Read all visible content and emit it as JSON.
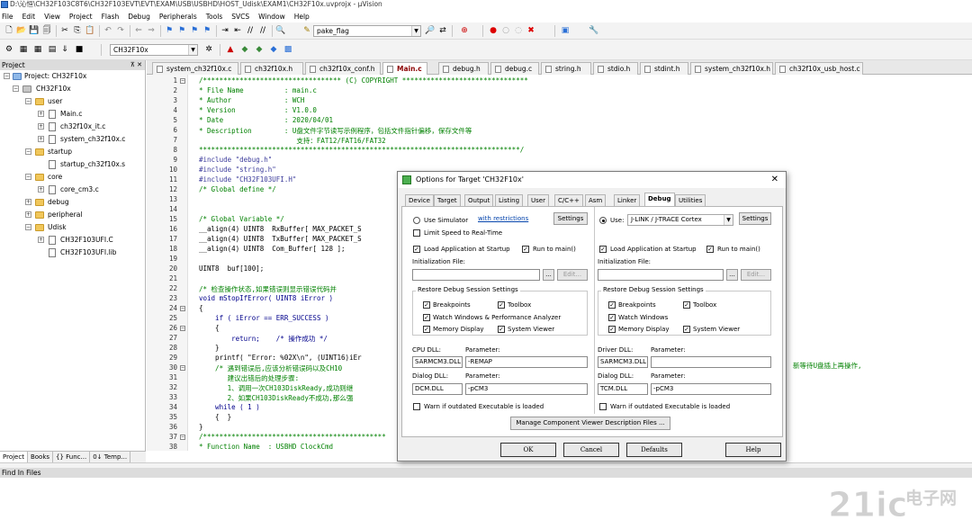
{
  "title_bar": "D:\\沁恒\\CH32F103C8T6\\CH32F103EVT\\EVT\\EXAM\\USB\\USBHD\\HOST_Udisk\\EXAM1\\CH32F10x.uvprojx - µVision",
  "menu": [
    "File",
    "Edit",
    "View",
    "Project",
    "Flash",
    "Debug",
    "Peripherals",
    "Tools",
    "SVCS",
    "Window",
    "Help"
  ],
  "toolbar": {
    "find_combo": "pake_flag",
    "target_combo": "CH32F10x"
  },
  "project": {
    "header": "Project",
    "root": "Project: CH32F10x",
    "target": "CH32F10x",
    "items": [
      {
        "label": "user",
        "level": 1,
        "type": "folder"
      },
      {
        "label": "Main.c",
        "level": 2,
        "type": "file"
      },
      {
        "label": "ch32f10x_it.c",
        "level": 2,
        "type": "file"
      },
      {
        "label": "system_ch32f10x.c",
        "level": 2,
        "type": "file"
      },
      {
        "label": "startup",
        "level": 1,
        "type": "folder"
      },
      {
        "label": "startup_ch32f10x.s",
        "level": 2,
        "type": "file"
      },
      {
        "label": "core",
        "level": 1,
        "type": "folder"
      },
      {
        "label": "core_cm3.c",
        "level": 2,
        "type": "file"
      },
      {
        "label": "debug",
        "level": 1,
        "type": "folder"
      },
      {
        "label": "peripheral",
        "level": 1,
        "type": "folder"
      },
      {
        "label": "Udisk",
        "level": 1,
        "type": "folder"
      },
      {
        "label": "CH32F103UFI.C",
        "level": 2,
        "type": "file"
      },
      {
        "label": "CH32F103UFI.lib",
        "level": 2,
        "type": "file"
      }
    ]
  },
  "bottom_tabs": [
    "Project",
    "Books",
    "{} Func...",
    "0↓ Temp..."
  ],
  "build_output_title": "Find In Files",
  "file_tabs": [
    {
      "label": "system_ch32f10x.c",
      "active": false
    },
    {
      "label": "ch32f10x.h",
      "active": false
    },
    {
      "label": "ch32f10x_conf.h",
      "active": false
    },
    {
      "label": "Main.c",
      "active": true
    },
    {
      "label": "debug.h",
      "active": false
    },
    {
      "label": "debug.c",
      "active": false
    },
    {
      "label": "string.h",
      "active": false
    },
    {
      "label": "stdio.h",
      "active": false
    },
    {
      "label": "stdint.h",
      "active": false
    },
    {
      "label": "system_ch32f10x.h",
      "active": false
    },
    {
      "label": "ch32f10x_usb_host.c",
      "active": false
    }
  ],
  "code_lines": [
    {
      "n": "1",
      "t": "/********************************** (C) COPYRIGHT *******************************",
      "c": "cm"
    },
    {
      "n": "2",
      "t": "* File Name          : main.c",
      "c": "cm"
    },
    {
      "n": "3",
      "t": "* Author             : WCH",
      "c": "cm"
    },
    {
      "n": "4",
      "t": "* Version            : V1.0.0",
      "c": "cm"
    },
    {
      "n": "5",
      "t": "* Date               : 2020/04/01",
      "c": "cm"
    },
    {
      "n": "6",
      "t": "* Description        : U盘文件字节读写示例程序，包括文件指针偏移，保存文件等",
      "c": "cm"
    },
    {
      "n": "7",
      "t": "                        支持：FAT12/FAT16/FAT32",
      "c": "cm"
    },
    {
      "n": "8",
      "t": "*******************************************************************************/",
      "c": "cm"
    },
    {
      "n": "9",
      "t": "#include \"debug.h\"",
      "c": "pp"
    },
    {
      "n": "10",
      "t": "#include \"string.h\"",
      "c": "pp"
    },
    {
      "n": "11",
      "t": "#include \"CH32F103UFI.H\"",
      "c": "pp"
    },
    {
      "n": "12",
      "t": "/* Global define */",
      "c": "cm"
    },
    {
      "n": "13",
      "t": "",
      "c": ""
    },
    {
      "n": "14",
      "t": "",
      "c": ""
    },
    {
      "n": "15",
      "t": "/* Global Variable */",
      "c": "cm"
    },
    {
      "n": "16",
      "t": "__align(4) UINT8  RxBuffer[ MAX_PACKET_S",
      "c": ""
    },
    {
      "n": "17",
      "t": "__align(4) UINT8  TxBuffer[ MAX_PACKET_S",
      "c": ""
    },
    {
      "n": "18",
      "t": "__align(4) UINT8  Com_Buffer[ 128 ];",
      "c": ""
    },
    {
      "n": "19",
      "t": "",
      "c": ""
    },
    {
      "n": "20",
      "t": "UINT8  buf[100];",
      "c": ""
    },
    {
      "n": "21",
      "t": "",
      "c": ""
    },
    {
      "n": "22",
      "t": "/* 检查操作状态,如果错误则显示错误代码并",
      "c": "cm"
    },
    {
      "n": "23",
      "t": "void mStopIfError( UINT8 iError )",
      "c": "kw"
    },
    {
      "n": "24",
      "t": "{",
      "c": ""
    },
    {
      "n": "25",
      "t": "    if ( iError == ERR_SUCCESS )",
      "c": "kw"
    },
    {
      "n": "26",
      "t": "    {",
      "c": ""
    },
    {
      "n": "27",
      "t": "        return;    /* 操作成功 */",
      "c": "kw"
    },
    {
      "n": "28",
      "t": "    }",
      "c": ""
    },
    {
      "n": "29",
      "t": "    printf( \"Error: %02X\\n\", (UINT16)iEr",
      "c": ""
    },
    {
      "n": "30",
      "t": "    /* 遇到错误后,应该分析错误码以及CH10",
      "c": "cm"
    },
    {
      "n": "31",
      "t": "       建议出错后的处理步骤:",
      "c": "cm"
    },
    {
      "n": "32",
      "t": "       1、调用一次CH103DiskReady,成功则继",
      "c": "cm"
    },
    {
      "n": "33",
      "t": "       2、如果CH103DiskReady不成功,那么强",
      "c": "cm"
    },
    {
      "n": "34",
      "t": "    while ( 1 )",
      "c": "kw"
    },
    {
      "n": "35",
      "t": "    {  }",
      "c": ""
    },
    {
      "n": "36",
      "t": "}",
      "c": ""
    },
    {
      "n": "37",
      "t": "/*********************************************",
      "c": "cm"
    },
    {
      "n": "38",
      "t": "* Function Name  : USBHD ClockCmd",
      "c": "cm"
    }
  ],
  "code_right_fragment": "新等待U盘插上再操作,",
  "dialog": {
    "title": "Options for Target 'CH32F10x'",
    "tabs": [
      "Device",
      "Target",
      "Output",
      "Listing",
      "User",
      "C/C++",
      "Asm",
      "Linker",
      "Debug",
      "Utilities"
    ],
    "selected_tab": "Debug",
    "left": {
      "use_simulator": "Use Simulator",
      "with_restrictions": "with restrictions",
      "settings": "Settings",
      "limit_speed": "Limit Speed to Real-Time",
      "load_app": "Load Application at Startup",
      "run_to_main": "Run to main()",
      "init_file": "Initialization File:",
      "browse": "...",
      "edit": "Edit...",
      "restore": "Restore Debug Session Settings",
      "breakpoints": "Breakpoints",
      "toolbox": "Toolbox",
      "watch": "Watch Windows & Performance Analyzer",
      "memory": "Memory Display",
      "system_viewer": "System Viewer",
      "dll_label": "CPU DLL:",
      "param_label": "Parameter:",
      "dll_value": "SARMCM3.DLL",
      "param_value": "-REMAP",
      "dialog_dll_label": "Dialog DLL:",
      "dialog_param_label": "Parameter:",
      "dialog_dll_value": "DCM.DLL",
      "dialog_param_value": "-pCM3",
      "warn": "Warn if outdated Executable is loaded"
    },
    "right": {
      "use": "Use:",
      "driver": "J-LINK / J-TRACE Cortex",
      "settings": "Settings",
      "load_app": "Load Application at Startup",
      "run_to_main": "Run to main()",
      "init_file": "Initialization File:",
      "browse": "...",
      "edit": "Edit...",
      "restore": "Restore Debug Session Settings",
      "breakpoints": "Breakpoints",
      "toolbox": "Toolbox",
      "watch": "Watch Windows",
      "memory": "Memory Display",
      "system_viewer": "System Viewer",
      "dll_label": "Driver DLL:",
      "param_label": "Parameter:",
      "dll_value": "SARMCM3.DLL",
      "param_value": "",
      "dialog_dll_label": "Dialog DLL:",
      "dialog_param_label": "Parameter:",
      "dialog_dll_value": "TCM.DLL",
      "dialog_param_value": "-pCM3",
      "warn": "Warn if outdated Executable is loaded"
    },
    "manage": "Manage Component Viewer Description Files ...",
    "buttons": {
      "ok": "OK",
      "cancel": "Cancel",
      "defaults": "Defaults",
      "help": "Help"
    }
  },
  "watermark": {
    "brand": "21ic",
    "cn": "电子网"
  },
  "colors": {
    "dialog_icon": "#4caf50",
    "active_tab_text": "#8b0000",
    "watermark": "#d0d0d0"
  }
}
